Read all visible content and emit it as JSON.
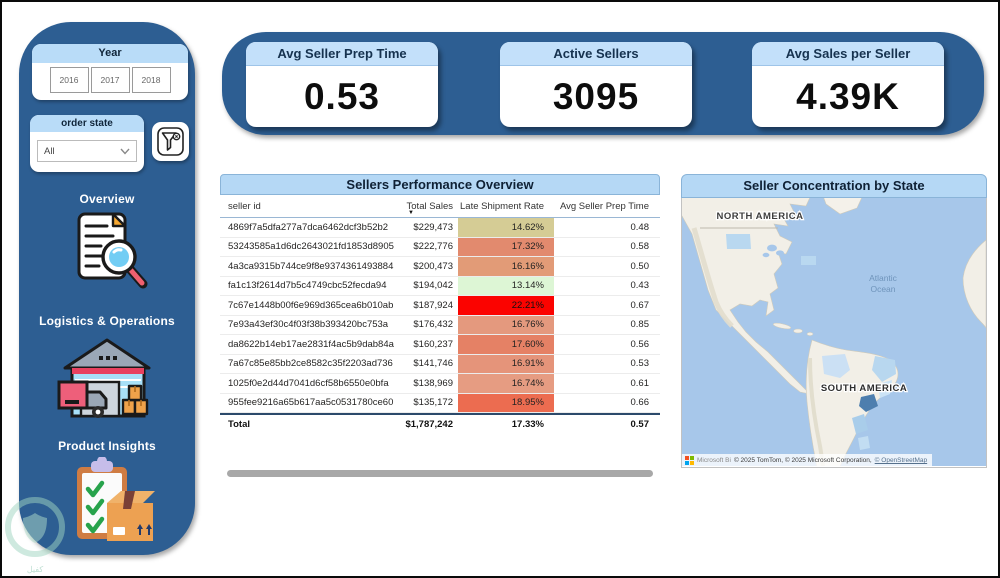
{
  "sidebar": {
    "year_panel": {
      "title": "Year",
      "options": [
        "2016",
        "2017",
        "2018"
      ]
    },
    "order_state_panel": {
      "title": "order state",
      "selected": "All"
    },
    "nav": [
      {
        "label": "Overview",
        "icon": "document-magnifier-icon"
      },
      {
        "label": "Logistics & Operations",
        "icon": "warehouse-truck-icon"
      },
      {
        "label": "Product Insights",
        "icon": "clipboard-box-icon"
      }
    ]
  },
  "kpis": [
    {
      "title": "Avg Seller Prep Time",
      "value": "0.53"
    },
    {
      "title": "Active Sellers",
      "value": "3095"
    },
    {
      "title": "Avg Sales per Seller",
      "value": "4.39K"
    }
  ],
  "table": {
    "title": "Sellers Performance Overview",
    "columns": [
      "seller id",
      "Total Sales",
      "Late Shipment Rate",
      "Avg Seller Prep Time"
    ],
    "sort": {
      "column": "Total Sales",
      "direction": "desc"
    },
    "rows": [
      {
        "seller_id": "4869f7a5dfa277a7dca6462dcf3b52b2",
        "total_sales": "$229,473",
        "late_rate": "14.62%",
        "rate_color": "#d5cc95",
        "prep_time": "0.48"
      },
      {
        "seller_id": "53243585a1d6dc2643021fd1853d8905",
        "total_sales": "$222,776",
        "late_rate": "17.32%",
        "rate_color": "#e28a6e",
        "prep_time": "0.58"
      },
      {
        "seller_id": "4a3ca9315b744ce9f8e9374361493884",
        "total_sales": "$200,473",
        "late_rate": "16.16%",
        "rate_color": "#e29b77",
        "prep_time": "0.50"
      },
      {
        "seller_id": "fa1c13f2614d7b5c4749cbc52fecda94",
        "total_sales": "$194,042",
        "late_rate": "13.14%",
        "rate_color": "#ddf6d5",
        "prep_time": "0.43"
      },
      {
        "seller_id": "7c67e1448b00f6e969d365cea6b010ab",
        "total_sales": "$187,924",
        "late_rate": "22.21%",
        "rate_color": "#fb0300",
        "prep_time": "0.67"
      },
      {
        "seller_id": "7e93a43ef30c4f03f38b393420bc753a",
        "total_sales": "$176,432",
        "late_rate": "16.76%",
        "rate_color": "#e4997e",
        "prep_time": "0.85"
      },
      {
        "seller_id": "da8622b14eb17ae2831f4ac5b9dab84a",
        "total_sales": "$160,237",
        "late_rate": "17.60%",
        "rate_color": "#e58165",
        "prep_time": "0.56"
      },
      {
        "seller_id": "7a67c85e85bb2ce8582c35f2203ad736",
        "total_sales": "$141,746",
        "late_rate": "16.91%",
        "rate_color": "#e5947a",
        "prep_time": "0.53"
      },
      {
        "seller_id": "1025f0e2d44d7041d6cf58b6550e0bfa",
        "total_sales": "$138,969",
        "late_rate": "16.74%",
        "rate_color": "#e69c82",
        "prep_time": "0.61"
      },
      {
        "seller_id": "955fee9216a65b617aa5c0531780ce60",
        "total_sales": "$135,172",
        "late_rate": "18.95%",
        "rate_color": "#ec6c50",
        "prep_time": "0.66"
      }
    ],
    "total": {
      "label": "Total",
      "total_sales": "$1,787,242",
      "late_rate": "17.33%",
      "prep_time": "0.57"
    }
  },
  "map": {
    "title": "Seller Concentration by State",
    "labels": {
      "north_america": "NORTH AMERICA",
      "atlantic_1": "Atlantic",
      "atlantic_2": "Ocean",
      "south_america": "SOUTH AMERICA"
    },
    "attribution": {
      "provider": "Microsoft Bi",
      "text": "© 2025 TomTom, © 2025 Microsoft Corporation, ",
      "link": "© OpenStreetMap"
    }
  },
  "watermark": {
    "text": "كفيل"
  },
  "colors": {
    "sidebar_blue": "#2d5e92",
    "panel_header_blue": "#b5d8f5",
    "card_header_blue": "#c3e0fa",
    "ocean": "#a7c7ea",
    "land": "#f2efe7",
    "state_highlight_light": "#bcd8f0",
    "state_highlight_dark": "#4d7eae",
    "scrollbar": "#a8a8a8"
  }
}
